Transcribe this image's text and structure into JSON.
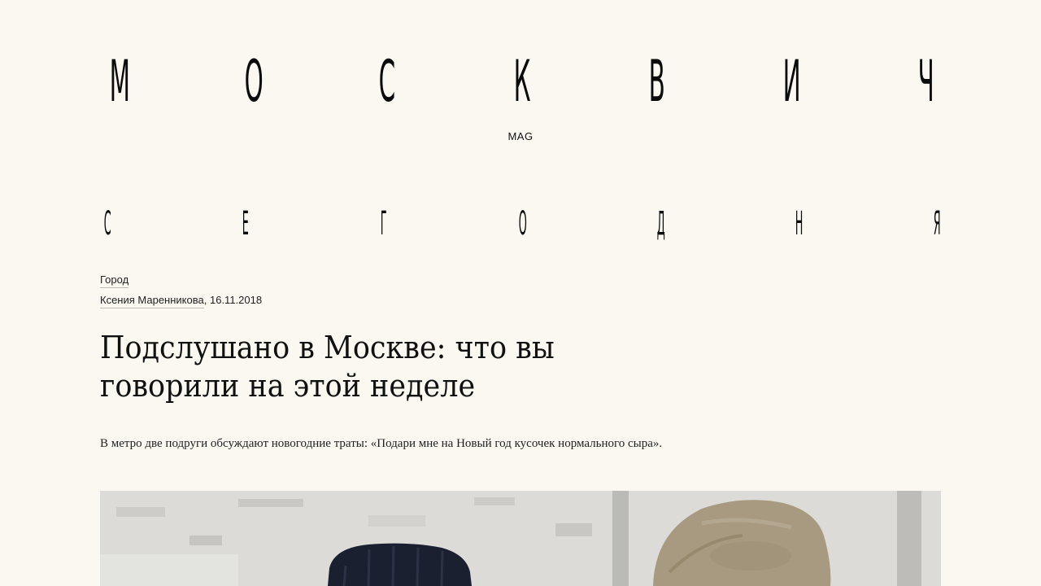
{
  "masthead": {
    "letters": [
      "М",
      "О",
      "С",
      "К",
      "В",
      "И",
      "Ч"
    ],
    "subtitle": "MAG"
  },
  "section": {
    "letters": [
      "С",
      "Е",
      "Г",
      "О",
      "Д",
      "Н",
      "Я"
    ]
  },
  "article": {
    "rubric": "Город",
    "author": "Ксения Маренникова",
    "date_sep": ",",
    "date": "16.11.2018",
    "title": "Подслушано в Москве: что вы говорили на этой неделе",
    "lead": "В метро две подруги обсуждают новогодние траты: «Подари мне на Новый год кусочек нормального сыра»."
  },
  "colors": {
    "background": "#faf8f0",
    "text": "#111111",
    "underline": "#bdbab0"
  }
}
